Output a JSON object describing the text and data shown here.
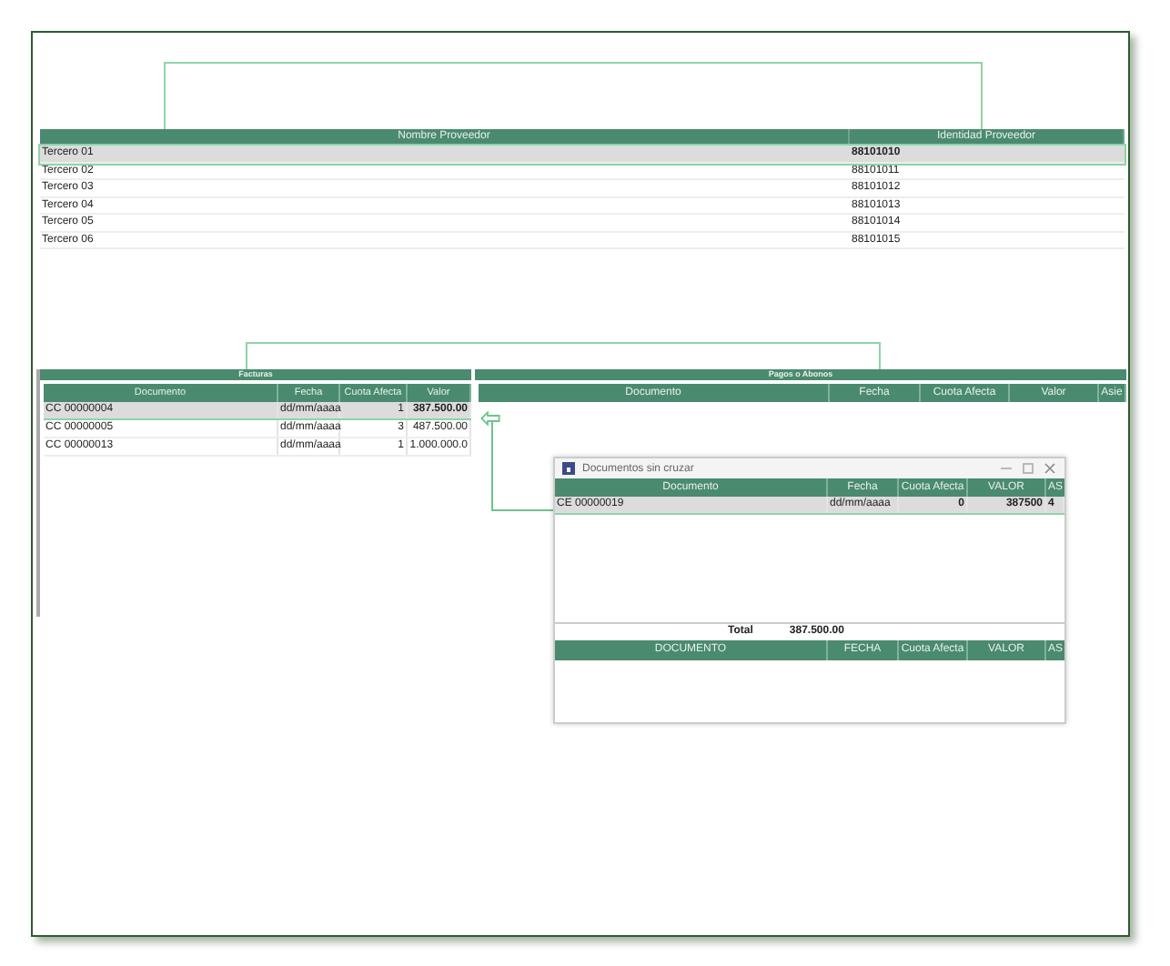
{
  "suppliers": {
    "columns": [
      "Nombre Proveedor",
      "Identidad Proveedor"
    ],
    "rows": [
      {
        "name": "Tercero 01",
        "id": "88101010",
        "selected": true
      },
      {
        "name": "Tercero 02",
        "id": "88101011",
        "selected": false
      },
      {
        "name": "Tercero 03",
        "id": "88101012",
        "selected": false
      },
      {
        "name": "Tercero 04",
        "id": "88101013",
        "selected": false
      },
      {
        "name": "Tercero 05",
        "id": "88101014",
        "selected": false
      },
      {
        "name": "Tercero 06",
        "id": "88101015",
        "selected": false
      }
    ]
  },
  "invoices": {
    "title": "Facturas",
    "columns": [
      "Documento",
      "Fecha",
      "Cuota Afecta",
      "Valor"
    ],
    "rows": [
      {
        "cells": [
          "CC  00000004",
          "dd/mm/aaaa",
          "1",
          "387.500.00"
        ],
        "selected": true
      },
      {
        "cells": [
          "CC  00000005",
          "dd/mm/aaaa",
          "3",
          "487.500.00"
        ],
        "selected": false
      },
      {
        "cells": [
          "CC  00000013",
          "dd/mm/aaaa",
          "1",
          "1.000.000.0"
        ],
        "selected": false
      }
    ]
  },
  "payments": {
    "title": "Pagos o Abonos",
    "columns": [
      "Documento",
      "Fecha",
      "Cuota Afecta",
      "Valor",
      "Asie"
    ]
  },
  "dialog": {
    "title": "Documentos sin cruzar",
    "columns": [
      "Documento",
      "Fecha",
      "Cuota Afecta",
      "VALOR",
      "AS"
    ],
    "rows": [
      {
        "cells": [
          "CE  00000019",
          "dd/mm/aaaa",
          "0",
          "387500",
          "4"
        ],
        "selected": true
      }
    ],
    "total_label": "Total",
    "total": "387.500.00",
    "bottom_columns": [
      "DOCUMENTO",
      "FECHA",
      "Cuota Afecta",
      "VALOR",
      "AS"
    ]
  }
}
